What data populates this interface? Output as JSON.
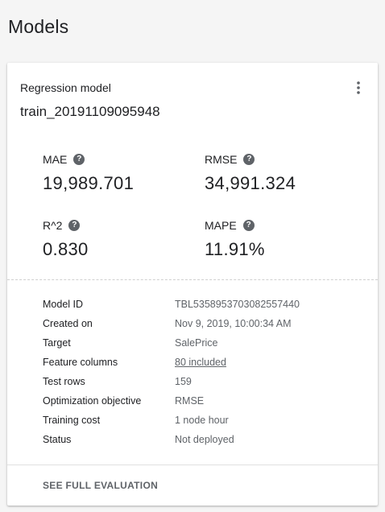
{
  "page": {
    "title": "Models"
  },
  "card": {
    "subtitle": "Regression model",
    "name": "train_20191109095948",
    "menu_icon": "more-vert-icon",
    "metrics": [
      {
        "label": "MAE",
        "value": "19,989.701"
      },
      {
        "label": "RMSE",
        "value": "34,991.324"
      },
      {
        "label": "R^2",
        "value": "0.830"
      },
      {
        "label": "MAPE",
        "value": "11.91%"
      }
    ],
    "details": [
      {
        "key": "Model ID",
        "value": "TBL5358953703082557440"
      },
      {
        "key": "Created on",
        "value": "Nov 9, 2019, 10:00:34 AM"
      },
      {
        "key": "Target",
        "value": "SalePrice"
      },
      {
        "key": "Feature columns",
        "value": "80 included"
      },
      {
        "key": "Test rows",
        "value": "159"
      },
      {
        "key": "Optimization objective",
        "value": "RMSE"
      },
      {
        "key": "Training cost",
        "value": "1 node hour"
      },
      {
        "key": "Status",
        "value": "Not deployed"
      }
    ],
    "footer_button": "SEE FULL EVALUATION"
  }
}
